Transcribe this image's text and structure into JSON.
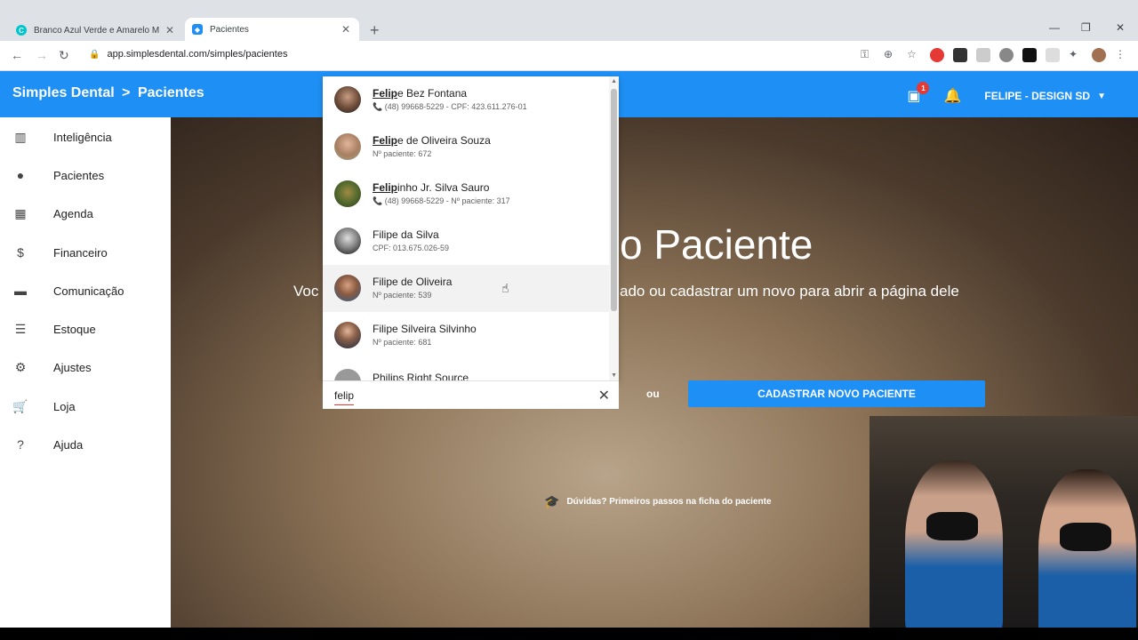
{
  "browser": {
    "tabs": [
      {
        "title": "Branco Azul Verde e Amarelo M",
        "favicon": "canva-icon"
      },
      {
        "title": "Pacientes",
        "favicon": "simplesdental-icon"
      }
    ],
    "url": "app.simplesdental.com/simples/pacientes"
  },
  "header": {
    "brand": "Simples Dental",
    "separator": ">",
    "section": "Pacientes",
    "notification_count": "1",
    "user": "FELIPE - DESIGN SD",
    "accent": "#1e90f5"
  },
  "sidebar": {
    "items": [
      {
        "label": "Inteligência",
        "icon": "chart-icon"
      },
      {
        "label": "Pacientes",
        "icon": "person-icon"
      },
      {
        "label": "Agenda",
        "icon": "calendar-icon"
      },
      {
        "label": "Financeiro",
        "icon": "money-icon"
      },
      {
        "label": "Comunicação",
        "icon": "chat-icon"
      },
      {
        "label": "Estoque",
        "icon": "clipboard-icon"
      },
      {
        "label": "Ajustes",
        "icon": "gear-icon"
      },
      {
        "label": "Loja",
        "icon": "cart-icon"
      },
      {
        "label": "Ajuda",
        "icon": "help-icon"
      }
    ]
  },
  "main": {
    "title_left": "Voc",
    "title_right": "o Paciente",
    "subtitle_right": "ado ou cadastrar um novo para abrir a página dele",
    "or": "ou",
    "cadastrar_label": "CADASTRAR NOVO PACIENTE",
    "help_link": "Dúvidas? Primeiros passos na ficha do paciente"
  },
  "search": {
    "query": "felip",
    "results": [
      {
        "match": "Felip",
        "rest": "e Bez Fontana",
        "sub": "(48) 99668-5229 - CPF: 423.611.276-01",
        "phone": true
      },
      {
        "match": "Felip",
        "rest": "e de Oliveira Souza",
        "sub": "Nº paciente: 672",
        "phone": false
      },
      {
        "match": "Felip",
        "rest": "inho Jr. Silva Sauro",
        "sub": "(48) 99668-5229 - Nº paciente: 317",
        "phone": true
      },
      {
        "match": "",
        "rest": "Filipe da Silva",
        "sub": "CPF: 013.675.026-59",
        "phone": false
      },
      {
        "match": "",
        "rest": "Filipe de Oliveira",
        "sub": "Nº paciente: 539",
        "phone": false
      },
      {
        "match": "",
        "rest": "Filipe Silveira Silvinho",
        "sub": "Nº paciente: 681",
        "phone": false
      },
      {
        "match": "",
        "rest": "Philips Right Source",
        "sub": "",
        "phone": false
      }
    ]
  }
}
